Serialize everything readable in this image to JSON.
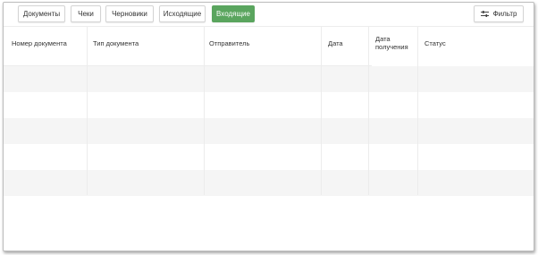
{
  "tabs": [
    {
      "label": "Документы",
      "active": false
    },
    {
      "label": "Чеки",
      "active": false
    },
    {
      "label": "Черновики",
      "active": false
    },
    {
      "label": "Исходящие",
      "active": false
    },
    {
      "label": "Входящие",
      "active": true
    }
  ],
  "filter": {
    "label": "Фильтр",
    "icon": "filter-icon"
  },
  "table": {
    "columns": [
      "Номер документа",
      "Тип документа",
      "Отправитель",
      "Дата",
      "Дата получения",
      "Статус"
    ],
    "rows": [
      {
        "cells": [
          "",
          "",
          "",
          "",
          "",
          ""
        ]
      },
      {
        "cells": [
          "",
          "",
          "",
          "",
          "",
          ""
        ]
      },
      {
        "cells": [
          "",
          "",
          "",
          "",
          "",
          ""
        ]
      },
      {
        "cells": [
          "",
          "",
          "",
          "",
          "",
          ""
        ]
      },
      {
        "cells": [
          "",
          "",
          "",
          "",
          "",
          ""
        ]
      }
    ]
  },
  "colors": {
    "accent": "#5aa55e",
    "row_shade": "#f5f5f5"
  }
}
